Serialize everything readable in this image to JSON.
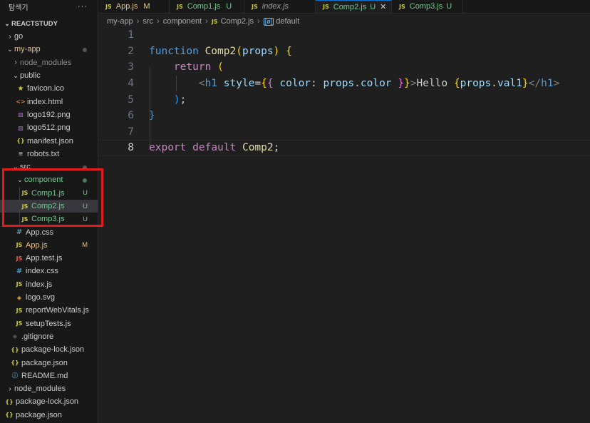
{
  "sidebar": {
    "title": "탐색기",
    "more": "···",
    "project": "REACTSTUDY",
    "items": [
      {
        "label": "go"
      },
      {
        "label": "my-app"
      },
      {
        "label": "node_modules"
      },
      {
        "label": "public"
      },
      {
        "label": "favicon.ico"
      },
      {
        "label": "index.html"
      },
      {
        "label": "logo192.png"
      },
      {
        "label": "logo512.png"
      },
      {
        "label": "manifest.json"
      },
      {
        "label": "robots.txt"
      },
      {
        "label": "src"
      },
      {
        "label": "component"
      },
      {
        "label": "Comp1.js",
        "status": "U"
      },
      {
        "label": "Comp2.js",
        "status": "U"
      },
      {
        "label": "Comp3.js",
        "status": "U"
      },
      {
        "label": "App.css"
      },
      {
        "label": "App.js",
        "status": "M"
      },
      {
        "label": "App.test.js"
      },
      {
        "label": "index.css"
      },
      {
        "label": "index.js"
      },
      {
        "label": "logo.svg"
      },
      {
        "label": "reportWebVitals.js"
      },
      {
        "label": "setupTests.js"
      },
      {
        "label": ".gitignore"
      },
      {
        "label": "package-lock.json"
      },
      {
        "label": "package.json"
      },
      {
        "label": "README.md"
      },
      {
        "label": "node_modules"
      },
      {
        "label": "package-lock.json"
      },
      {
        "label": "package.json"
      }
    ]
  },
  "tabs": [
    {
      "label": "App.js",
      "status": "M"
    },
    {
      "label": "Comp1.js",
      "status": "U"
    },
    {
      "label": "index.js",
      "status": ""
    },
    {
      "label": "Comp2.js",
      "status": "U",
      "close": "✕"
    },
    {
      "label": "Comp3.js",
      "status": "U"
    }
  ],
  "breadcrumb": {
    "parts": [
      "my-app",
      "src",
      "component",
      "Comp2.js",
      "default"
    ],
    "symbol_icon": "[ø]"
  },
  "editor": {
    "line_numbers": [
      "1",
      "2",
      "3",
      "4",
      "5",
      "6",
      "7",
      "8"
    ],
    "lines": [
      "",
      "function Comp2(props) {",
      "    return (",
      "        <h1 style={{ color: props.color }}>Hello {props.val1}</h1>",
      "    );",
      "}",
      "",
      "export default Comp2;"
    ]
  },
  "colors": {
    "untracked": "#73c991",
    "modified": "#e2c08d",
    "highlight_box": "#e21b1b"
  }
}
